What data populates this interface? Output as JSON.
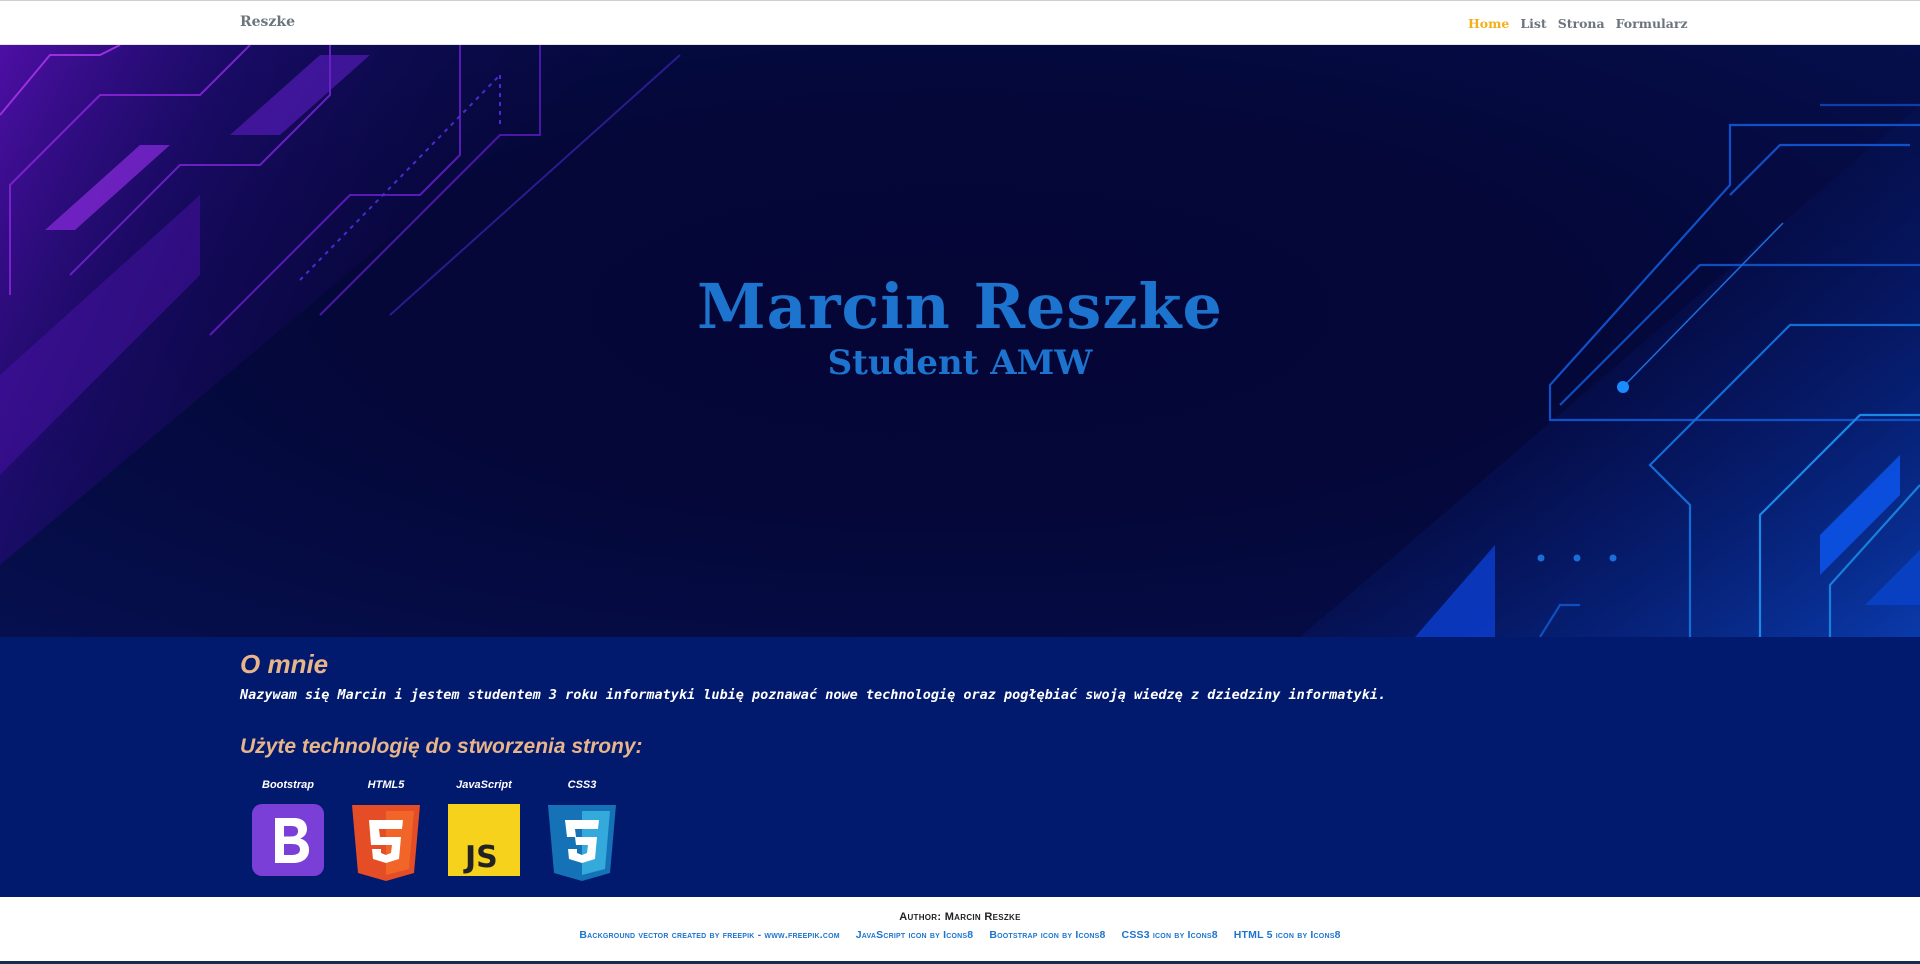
{
  "navbar": {
    "brand": "Reszke",
    "links": [
      {
        "label": "Home",
        "active": true
      },
      {
        "label": "List",
        "active": false
      },
      {
        "label": "Strona",
        "active": false
      },
      {
        "label": "Formularz",
        "active": false
      }
    ]
  },
  "hero": {
    "title": "Marcin Reszke",
    "subtitle": "Student AMW"
  },
  "about": {
    "heading": "O mnie",
    "text": "Nazywam się Marcin i jestem studentem 3 roku informatyki lubię poznawać nowe technologię oraz pogłębiać swoją wiedzę z dziedziny informatyki.",
    "tech_heading": "Użyte technologię do stworzenia strony:",
    "technologies": [
      {
        "label": "Bootstrap",
        "icon": "bootstrap-icon"
      },
      {
        "label": "HTML5",
        "icon": "html5-icon"
      },
      {
        "label": "JavaScript",
        "icon": "javascript-icon"
      },
      {
        "label": "CSS3",
        "icon": "css3-icon"
      }
    ]
  },
  "footer": {
    "author": "Author: Marcin Reszke",
    "credits": [
      "Background vector created by freepik - www.freepik.com",
      "JavaScript icon by Icons8",
      "Bootstrap icon by Icons8",
      "CSS3 icon by Icons8",
      "HTML 5 icon by Icons8"
    ]
  },
  "colors": {
    "accent_title": "#1c74cf",
    "nav_active": "#f3b017",
    "section_bg": "#021a6e",
    "heading_peach": "#e8b48a"
  }
}
